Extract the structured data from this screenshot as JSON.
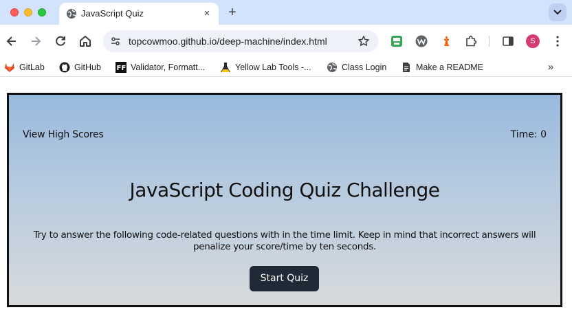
{
  "browser": {
    "tab": {
      "title": "JavaScript Quiz",
      "favicon": "globe-icon",
      "close": "×"
    },
    "new_tab": "+",
    "address": {
      "url": "topcowmoo.github.io/deep-machine/index.html"
    },
    "profile": {
      "initial": "S",
      "color": "#d63b73"
    },
    "bookmarks": [
      {
        "label": "GitLab",
        "icon": "gitlab-icon"
      },
      {
        "label": "GitHub",
        "icon": "github-icon"
      },
      {
        "label": "Validator, Formatt...",
        "icon": "ff-icon"
      },
      {
        "label": "Yellow Lab Tools -...",
        "icon": "flask-icon"
      },
      {
        "label": "Class Login",
        "icon": "globe-icon"
      },
      {
        "label": "Make a README",
        "icon": "document-icon"
      }
    ],
    "bookmarks_overflow": "»"
  },
  "quiz": {
    "high_scores_link": "View High Scores",
    "timer": "Time: 0",
    "title": "JavaScript Coding Quiz Challenge",
    "description": "Try to answer the following code-related questions with in the time limit. Keep in mind that incorrect answers will penalize your score/time by ten seconds.",
    "start_button": "Start Quiz"
  },
  "colors": {
    "tabstrip": "#d3e3fd",
    "gradient_top": "#98b9de",
    "gradient_bottom": "#d7dadc",
    "button_bg": "#1f2a36"
  }
}
